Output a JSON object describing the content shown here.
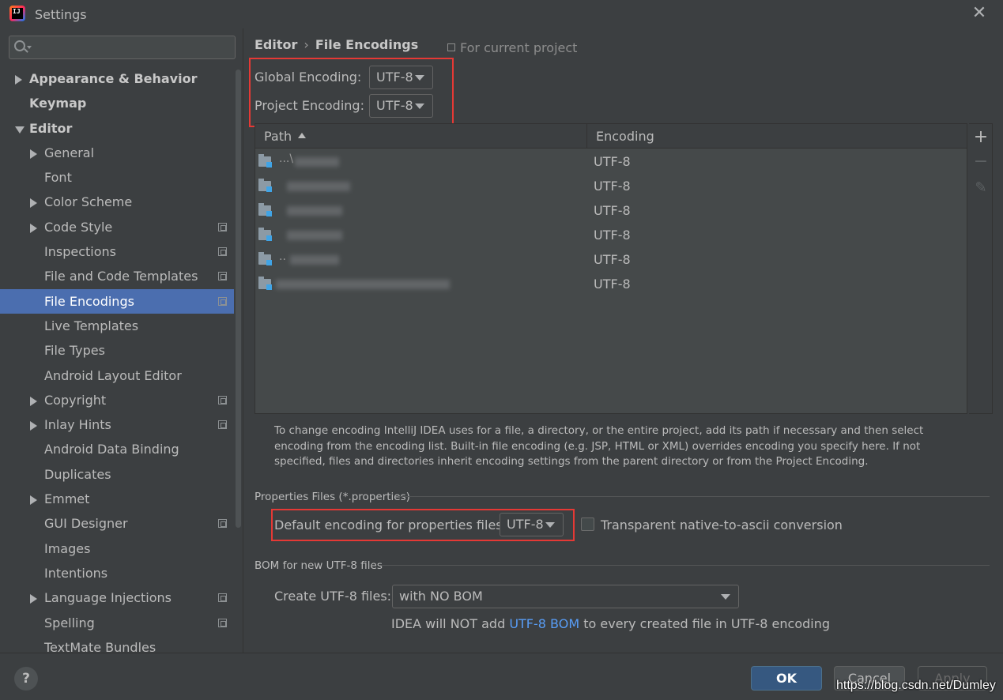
{
  "window": {
    "title": "Settings",
    "close_glyph": "✕",
    "app_icon_text": "IJ"
  },
  "sidebar": {
    "search_placeholder": "",
    "items": [
      {
        "label": "Appearance & Behavior",
        "level": 0,
        "arrow": "right",
        "bold": true,
        "project": false,
        "selected": false
      },
      {
        "label": "Keymap",
        "level": 0,
        "arrow": "none",
        "bold": true,
        "project": false,
        "selected": false
      },
      {
        "label": "Editor",
        "level": 0,
        "arrow": "down",
        "bold": true,
        "project": false,
        "selected": false
      },
      {
        "label": "General",
        "level": 1,
        "arrow": "right",
        "bold": false,
        "project": false,
        "selected": false
      },
      {
        "label": "Font",
        "level": 1,
        "arrow": "none",
        "bold": false,
        "project": false,
        "selected": false
      },
      {
        "label": "Color Scheme",
        "level": 1,
        "arrow": "right",
        "bold": false,
        "project": false,
        "selected": false
      },
      {
        "label": "Code Style",
        "level": 1,
        "arrow": "right",
        "bold": false,
        "project": true,
        "selected": false
      },
      {
        "label": "Inspections",
        "level": 1,
        "arrow": "none",
        "bold": false,
        "project": true,
        "selected": false
      },
      {
        "label": "File and Code Templates",
        "level": 1,
        "arrow": "none",
        "bold": false,
        "project": true,
        "selected": false
      },
      {
        "label": "File Encodings",
        "level": 1,
        "arrow": "none",
        "bold": false,
        "project": true,
        "selected": true
      },
      {
        "label": "Live Templates",
        "level": 1,
        "arrow": "none",
        "bold": false,
        "project": false,
        "selected": false
      },
      {
        "label": "File Types",
        "level": 1,
        "arrow": "none",
        "bold": false,
        "project": false,
        "selected": false
      },
      {
        "label": "Android Layout Editor",
        "level": 1,
        "arrow": "none",
        "bold": false,
        "project": false,
        "selected": false
      },
      {
        "label": "Copyright",
        "level": 1,
        "arrow": "right",
        "bold": false,
        "project": true,
        "selected": false
      },
      {
        "label": "Inlay Hints",
        "level": 1,
        "arrow": "right",
        "bold": false,
        "project": true,
        "selected": false
      },
      {
        "label": "Android Data Binding",
        "level": 1,
        "arrow": "none",
        "bold": false,
        "project": false,
        "selected": false
      },
      {
        "label": "Duplicates",
        "level": 1,
        "arrow": "none",
        "bold": false,
        "project": false,
        "selected": false
      },
      {
        "label": "Emmet",
        "level": 1,
        "arrow": "right",
        "bold": false,
        "project": false,
        "selected": false
      },
      {
        "label": "GUI Designer",
        "level": 1,
        "arrow": "none",
        "bold": false,
        "project": true,
        "selected": false
      },
      {
        "label": "Images",
        "level": 1,
        "arrow": "none",
        "bold": false,
        "project": false,
        "selected": false
      },
      {
        "label": "Intentions",
        "level": 1,
        "arrow": "none",
        "bold": false,
        "project": false,
        "selected": false
      },
      {
        "label": "Language Injections",
        "level": 1,
        "arrow": "right",
        "bold": false,
        "project": true,
        "selected": false
      },
      {
        "label": "Spelling",
        "level": 1,
        "arrow": "none",
        "bold": false,
        "project": true,
        "selected": false
      },
      {
        "label": "TextMate Bundles",
        "level": 1,
        "arrow": "none",
        "bold": false,
        "project": false,
        "selected": false
      }
    ]
  },
  "main": {
    "breadcrumb": {
      "parent": "Editor",
      "separator": "›",
      "current": "File Encodings"
    },
    "current_project_label": "For current project",
    "global_encoding": {
      "label": "Global Encoding:",
      "value": "UTF-8"
    },
    "project_encoding": {
      "label": "Project Encoding:",
      "value": "UTF-8"
    },
    "table": {
      "headers": {
        "path": "Path",
        "encoding": "Encoding"
      },
      "rows": [
        {
          "path": "...\\",
          "encoding": "UTF-8"
        },
        {
          "path": "",
          "encoding": "UTF-8"
        },
        {
          "path": "",
          "encoding": "UTF-8"
        },
        {
          "path": "",
          "encoding": "UTF-8"
        },
        {
          "path": "..",
          "encoding": "UTF-8"
        },
        {
          "path": "",
          "encoding": "UTF-8"
        }
      ],
      "tools": {
        "add": "+",
        "remove": "−",
        "edit": "✎"
      }
    },
    "description": "To change encoding IntelliJ IDEA uses for a file, a directory, or the entire project, add its path if necessary and then select encoding from the encoding list. Built-in file encoding (e.g. JSP, HTML or XML) overrides encoding you specify here. If not specified, files and directories inherit encoding settings from the parent directory or from the Project Encoding.",
    "properties": {
      "section_title": "Properties Files (*.properties)",
      "default_label": "Default encoding for properties files:",
      "default_value": "UTF-8",
      "transparent_label": "Transparent native-to-ascii conversion",
      "transparent_checked": false
    },
    "bom": {
      "section_title": "BOM for new UTF-8 files",
      "create_label": "Create UTF-8 files:",
      "create_value": "with NO BOM",
      "note_prefix": "IDEA will NOT add ",
      "note_link": "UTF-8 BOM",
      "note_suffix": " to every created file in UTF-8 encoding"
    }
  },
  "footer": {
    "help": "?",
    "ok": "OK",
    "cancel": "Cancel",
    "apply": "Apply",
    "watermark": "https://blog.csdn.net/Dumley"
  },
  "colors": {
    "accent": "#4b6eaf",
    "highlight_box": "#e53935",
    "link": "#589df6",
    "background": "#3c3f41"
  }
}
